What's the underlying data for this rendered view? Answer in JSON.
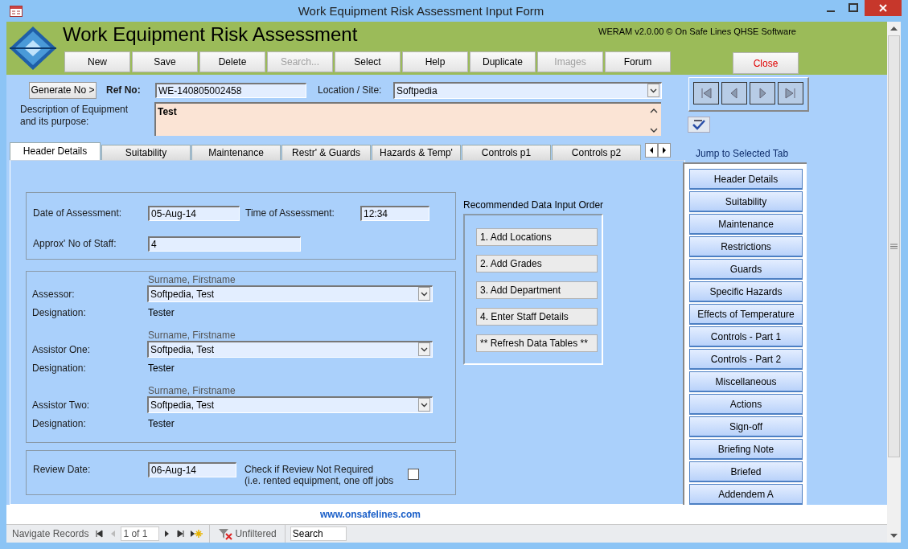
{
  "window": {
    "title": "Work Equipment Risk Assessment Input Form"
  },
  "header": {
    "title": "Work Equipment Risk Assessment",
    "version": "WERAM v2.0.00 © On Safe Lines QHSE Software"
  },
  "toolbar": [
    {
      "label": "New",
      "disabled": false
    },
    {
      "label": "Save",
      "disabled": false
    },
    {
      "label": "Delete",
      "disabled": false
    },
    {
      "label": "Search...",
      "disabled": true
    },
    {
      "label": "Select",
      "disabled": false
    },
    {
      "label": "Help",
      "disabled": false
    },
    {
      "label": "Duplicate",
      "disabled": false
    },
    {
      "label": "Images",
      "disabled": true
    },
    {
      "label": "Forum",
      "disabled": false
    }
  ],
  "close_button": {
    "label": "Close"
  },
  "generate_button": {
    "label": "Generate No >"
  },
  "ref_no": {
    "label": "Ref No:",
    "value": "WE-140805002458"
  },
  "location": {
    "label": "Location / Site:",
    "value": "Softpedia"
  },
  "description": {
    "label": "Description of Equipment and its purpose:",
    "value": "Test"
  },
  "tabs": [
    {
      "label": "Header Details",
      "selected": true
    },
    {
      "label": "Suitability",
      "selected": false
    },
    {
      "label": "Maintenance",
      "selected": false
    },
    {
      "label": "Restr' & Guards",
      "selected": false
    },
    {
      "label": "Hazards & Temp'",
      "selected": false
    },
    {
      "label": "Controls p1",
      "selected": false
    },
    {
      "label": "Controls p2",
      "selected": false
    }
  ],
  "assessment": {
    "date_label": "Date of Assessment:",
    "date": "05-Aug-14",
    "time_label": "Time of Assessment:",
    "time": "12:34",
    "staff_label": "Approx' No of Staff:",
    "staff": "4"
  },
  "people": [
    {
      "hint": "Surname, Firstname",
      "label": "Assessor:",
      "value": "Softpedia, Test",
      "designation_label": "Designation:",
      "designation": "Tester"
    },
    {
      "hint": "Surname, Firstname",
      "label": "Assistor One:",
      "value": "Softpedia, Test",
      "designation_label": "Designation:",
      "designation": "Tester"
    },
    {
      "hint": "Surname, Firstname",
      "label": "Assistor Two:",
      "value": "Softpedia, Test",
      "designation_label": "Designation:",
      "designation": "Tester"
    }
  ],
  "review": {
    "label": "Review Date:",
    "value": "06-Aug-14",
    "check_label": "Check if Review Not Required",
    "check_note": "(i.e. rented equipment, one off jobs",
    "checked": false
  },
  "input_order": {
    "title": "Recommended Data Input Order",
    "buttons": [
      "1. Add Locations",
      "2. Add Grades",
      "3. Add Department",
      "4. Enter Staff Details",
      "** Refresh Data Tables **"
    ]
  },
  "jump": {
    "title": "Jump to Selected Tab",
    "items": [
      "Header Details",
      "Suitability",
      "Maintenance",
      "Restrictions",
      "Guards",
      "Specific Hazards",
      "Effects of Temperature",
      "Controls - Part 1",
      "Controls - Part 2",
      "Miscellaneous",
      "Actions",
      "Sign-off",
      "Briefing Note",
      "Briefed",
      "Addendem A"
    ]
  },
  "website": "www.onsafelines.com",
  "status_bar": {
    "label": "Navigate Records",
    "record": "1 of 1",
    "filter": "Unfiltered",
    "search": "Search"
  }
}
